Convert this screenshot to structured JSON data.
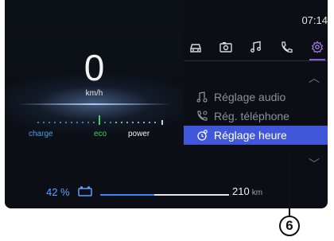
{
  "status": {
    "time": "07:14"
  },
  "cluster": {
    "speed": "0",
    "speed_unit": "km/h",
    "mode_labels": {
      "charge": "charge",
      "eco": "eco",
      "power": "power"
    },
    "battery_percent": "42 %",
    "range_value": "210",
    "range_unit": "km",
    "battery_level": 0.42
  },
  "tabs": [
    {
      "icon": "car-icon",
      "active": false
    },
    {
      "icon": "camera-icon",
      "active": false
    },
    {
      "icon": "music-note-icon",
      "active": false
    },
    {
      "icon": "phone-icon",
      "active": false
    },
    {
      "icon": "gear-icon",
      "active": true
    }
  ],
  "menu": {
    "items": [
      {
        "label": "Réglage audio",
        "icon": "audio-settings-icon",
        "selected": false
      },
      {
        "label": "Rég. téléphone",
        "icon": "phone-settings-icon",
        "selected": false
      },
      {
        "label": "Réglage heure",
        "icon": "clock-settings-icon",
        "selected": true
      }
    ]
  },
  "callout": {
    "label": "6"
  },
  "colors": {
    "accent": "#8d5bd8",
    "selection": "#3f57d8",
    "charge": "#4b9fe6",
    "eco": "#3fd16a"
  }
}
